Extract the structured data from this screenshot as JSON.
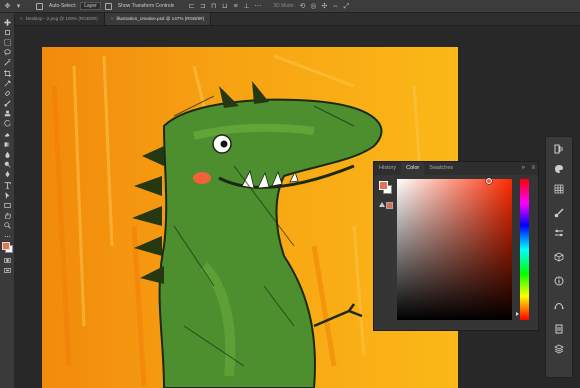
{
  "options_bar": {
    "auto_select_label": "Auto-Select:",
    "auto_select_target": "Layer",
    "show_transform_label": "Show Transform Controls",
    "mode_3d_label": "3D Mode:"
  },
  "document_tabs": [
    {
      "label": "Desktop - 2.png @ 100% (RGB/8#)",
      "active": false
    },
    {
      "label": "illustration_creative.psd @ 147% (RGB/8#)",
      "active": true
    }
  ],
  "panel": {
    "tabs": [
      "History",
      "Color",
      "Swatches"
    ],
    "active_tab": "Color",
    "foreground_color": "#e8715a",
    "background_color": "#ffffff",
    "selected_hue": "#ff2a00"
  },
  "artwork": {
    "background_color": "#f9b015",
    "dino_color": "#4d8f2e"
  }
}
